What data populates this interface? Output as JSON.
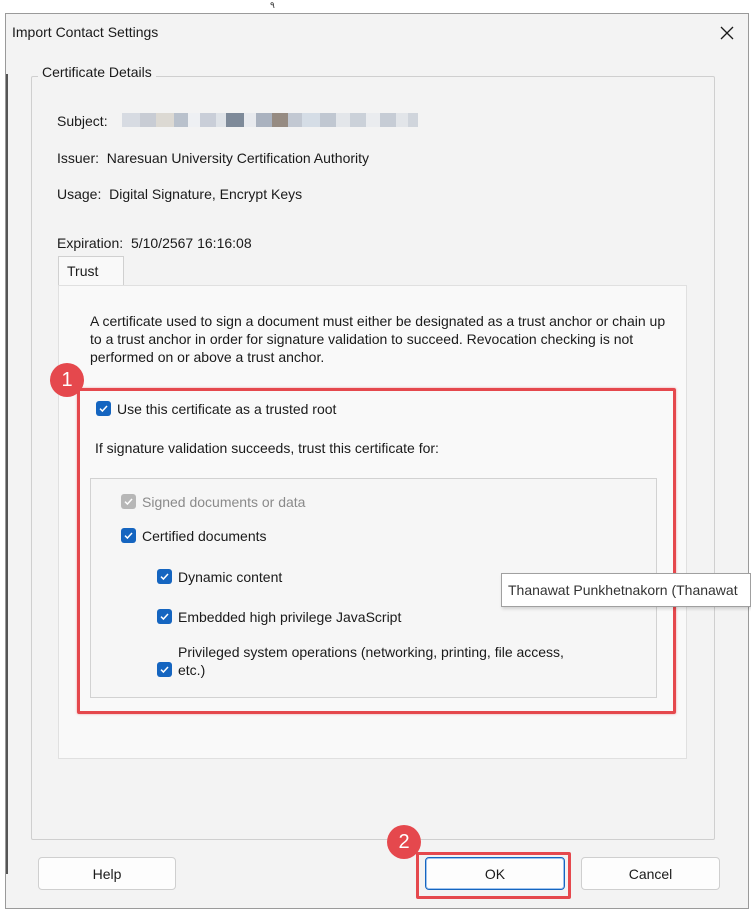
{
  "window": {
    "title": "Import Contact Settings",
    "top_tick": "٩"
  },
  "certificate": {
    "legend": "Certificate Details",
    "subject_label": "Subject:",
    "issuer_label": "Issuer:",
    "issuer_value": "Naresuan University Certification Authority",
    "usage_label": "Usage:",
    "usage_value": "Digital Signature, Encrypt Keys",
    "expiration_label": "Expiration:",
    "expiration_value": "5/10/2567 16:16:08"
  },
  "tabs": [
    {
      "label": "Trust"
    }
  ],
  "trust": {
    "description": "A certificate used to sign a document must either be designated as a trust anchor or chain up to a trust anchor in order for signature validation to succeed.  Revocation checking is not performed on or above a trust anchor.",
    "trusted_root_label": "Use this certificate as a trusted root",
    "trust_for_label": "If signature validation succeeds, trust this certificate for:",
    "options": {
      "signed_documents": "Signed documents or data",
      "certified_documents": "Certified documents",
      "dynamic_content": "Dynamic content",
      "embedded_js": "Embedded high privilege JavaScript",
      "privileged_ops_line1": "Privileged system operations (networking, printing, file access,",
      "privileged_ops_line2": "etc.)"
    }
  },
  "tooltip": {
    "text": "Thanawat Punkhetnakorn (Thanawat"
  },
  "annotations": {
    "badge_1": "1",
    "badge_2": "2"
  },
  "buttons": {
    "help": "Help",
    "ok": "OK",
    "cancel": "Cancel"
  },
  "colors": {
    "accent": "#1565c0",
    "annotation": "#e5484d",
    "disabled": "#b7b7b7"
  }
}
